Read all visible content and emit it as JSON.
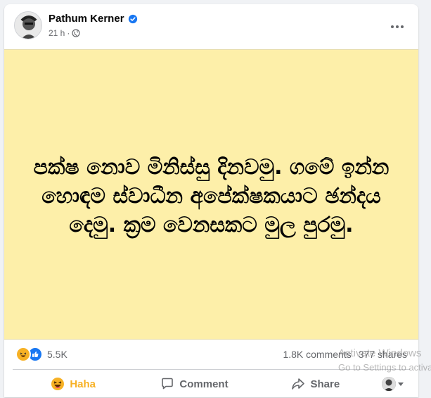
{
  "post": {
    "author": "Pathum Kerner",
    "time": "21 h",
    "separator": "·",
    "text": "පක්ෂ නොව මිනිස්සු දිනවමු. ගමේ ඉන්න හොඳම ස්වාධීන අපේක්ෂකයාට ඡන්දය දෙමු. ක්‍රම වෙනසකට මුල පුරමු.",
    "background_color": "#fdefa9"
  },
  "stats": {
    "reactions_count": "5.5K",
    "comments": "1.8K comments",
    "shares": "377 shares"
  },
  "actions": {
    "haha": "Haha",
    "comment": "Comment",
    "share": "Share"
  },
  "watermark": {
    "line1": "Activate Windows",
    "line2": "Go to Settings to activate Windows."
  },
  "colors": {
    "accent_blue": "#1877f2",
    "haha_yellow": "#f7b125",
    "secondary_text": "#65676b"
  }
}
